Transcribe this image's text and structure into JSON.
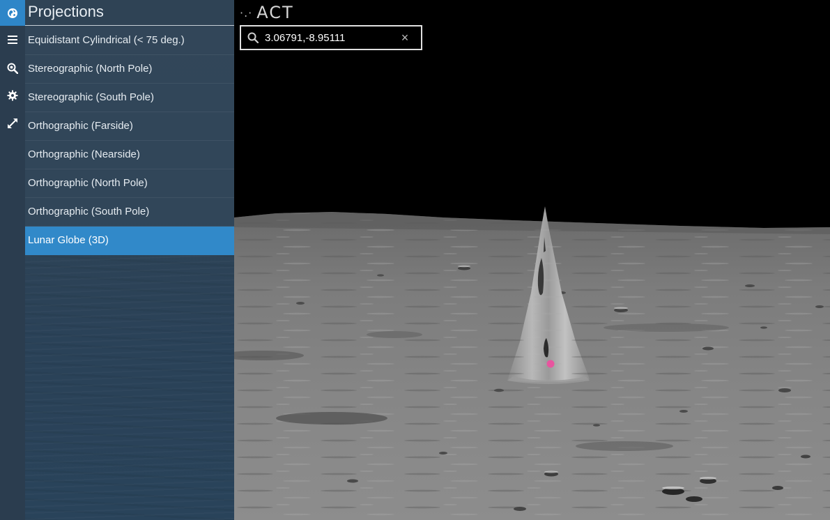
{
  "rail": {
    "items": [
      {
        "name": "globe-icon",
        "active": true
      },
      {
        "name": "menu-icon",
        "active": false
      },
      {
        "name": "search-zoom-icon",
        "active": false
      },
      {
        "name": "gear-icon",
        "active": false
      },
      {
        "name": "expand-icon",
        "active": false
      }
    ]
  },
  "panel": {
    "title": "Projections",
    "items": [
      {
        "label": "Equidistant Cylindrical (< 75 deg.)",
        "selected": false
      },
      {
        "label": "Stereographic (North Pole)",
        "selected": false
      },
      {
        "label": "Stereographic (South Pole)",
        "selected": false
      },
      {
        "label": "Orthographic (Farside)",
        "selected": false
      },
      {
        "label": "Orthographic (Nearside)",
        "selected": false
      },
      {
        "label": "Orthographic (North Pole)",
        "selected": false
      },
      {
        "label": "Orthographic (South Pole)",
        "selected": false
      },
      {
        "label": "Lunar Globe (3D)",
        "selected": true
      }
    ]
  },
  "map": {
    "logo_dots": "·.·",
    "logo_text": "ACT",
    "search": {
      "value": "3.06791,-8.95111",
      "clear_glyph": "×"
    },
    "marker_color": "#e8559f"
  },
  "colors": {
    "accent": "#3189c9",
    "rail_bg": "#2b3d4f",
    "panel_bg": "#2f4355"
  }
}
